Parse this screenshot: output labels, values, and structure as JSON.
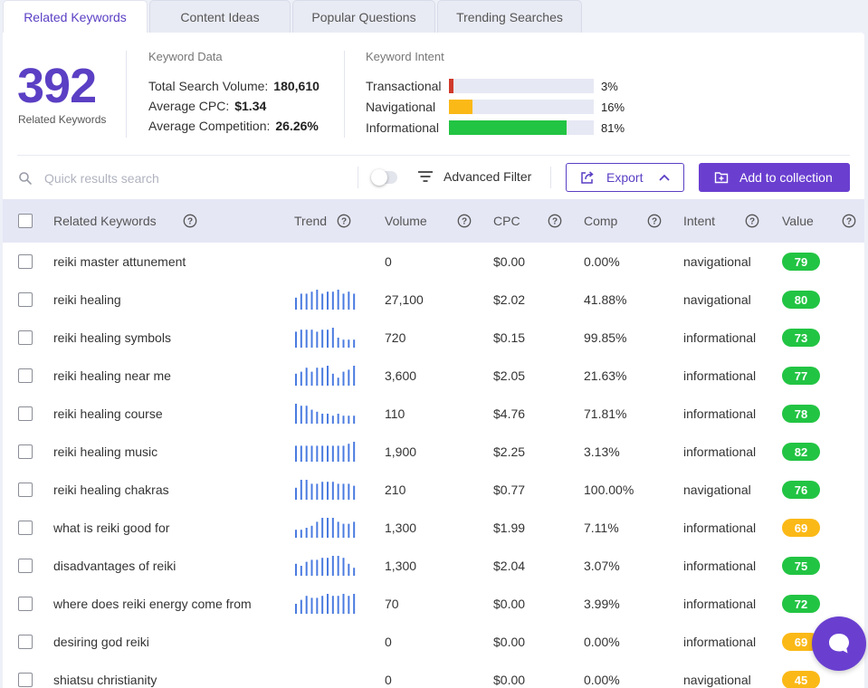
{
  "tabs": [
    {
      "label": "Related Keywords",
      "active": true
    },
    {
      "label": "Content Ideas",
      "active": false
    },
    {
      "label": "Popular Questions",
      "active": false
    },
    {
      "label": "Trending Searches",
      "active": false
    }
  ],
  "summary": {
    "count": "392",
    "count_label": "Related Keywords",
    "keyword_data_label": "Keyword Data",
    "total_volume_label": "Total Search Volume:",
    "total_volume": "180,610",
    "avg_cpc_label": "Average CPC:",
    "avg_cpc": "$1.34",
    "avg_comp_label": "Average Competition:",
    "avg_comp": "26.26%"
  },
  "intent": {
    "label": "Keyword Intent",
    "items": [
      {
        "name": "Transactional",
        "pct_label": "3%",
        "fraction": 0.03,
        "color": "#d0392b"
      },
      {
        "name": "Navigational",
        "pct_label": "16%",
        "fraction": 0.16,
        "color": "#fbb917"
      },
      {
        "name": "Informational",
        "pct_label": "81%",
        "fraction": 0.81,
        "color": "#22c443"
      }
    ]
  },
  "toolbar": {
    "search_placeholder": "Quick results search",
    "filter_label": "Advanced Filter",
    "export_label": "Export",
    "collection_label": "Add to collection"
  },
  "columns": {
    "keyword": "Related Keywords",
    "trend": "Trend",
    "volume": "Volume",
    "cpc": "CPC",
    "comp": "Comp",
    "intent": "Intent",
    "value": "Value"
  },
  "colors": {
    "accent": "#5b3fc4",
    "trend_bar": "#4a7be0",
    "value_green": "#22c443",
    "value_amber": "#fbb917"
  },
  "rows": [
    {
      "keyword": "reiki master attunement",
      "trend": [],
      "volume": "0",
      "cpc": "$0.00",
      "comp": "0.00%",
      "intent": "navigational",
      "value": "79",
      "value_color": "green"
    },
    {
      "keyword": "reiki healing",
      "trend": [
        0.6,
        0.8,
        0.8,
        0.9,
        1.0,
        0.8,
        0.9,
        0.9,
        1.0,
        0.8,
        0.9,
        0.8
      ],
      "volume": "27,100",
      "cpc": "$2.02",
      "comp": "41.88%",
      "intent": "navigational",
      "value": "80",
      "value_color": "green"
    },
    {
      "keyword": "reiki healing symbols",
      "trend": [
        0.8,
        0.9,
        0.9,
        0.9,
        0.8,
        0.9,
        0.9,
        1.0,
        0.5,
        0.4,
        0.4,
        0.4
      ],
      "volume": "720",
      "cpc": "$0.15",
      "comp": "99.85%",
      "intent": "informational",
      "value": "73",
      "value_color": "green"
    },
    {
      "keyword": "reiki healing near me",
      "trend": [
        0.6,
        0.7,
        0.9,
        0.7,
        0.9,
        0.9,
        1.0,
        0.6,
        0.4,
        0.7,
        0.8,
        1.0
      ],
      "volume": "3,600",
      "cpc": "$2.05",
      "comp": "21.63%",
      "intent": "informational",
      "value": "77",
      "value_color": "green"
    },
    {
      "keyword": "reiki healing course",
      "trend": [
        1.0,
        0.9,
        0.9,
        0.7,
        0.6,
        0.5,
        0.5,
        0.4,
        0.5,
        0.4,
        0.4,
        0.4
      ],
      "volume": "110",
      "cpc": "$4.76",
      "comp": "71.81%",
      "intent": "informational",
      "value": "78",
      "value_color": "green"
    },
    {
      "keyword": "reiki healing music",
      "trend": [
        0.8,
        0.8,
        0.8,
        0.8,
        0.8,
        0.8,
        0.8,
        0.8,
        0.8,
        0.8,
        0.9,
        1.0
      ],
      "volume": "1,900",
      "cpc": "$2.25",
      "comp": "3.13%",
      "intent": "informational",
      "value": "82",
      "value_color": "green"
    },
    {
      "keyword": "reiki healing chakras",
      "trend": [
        0.6,
        1.0,
        1.0,
        0.8,
        0.8,
        0.9,
        0.9,
        0.9,
        0.8,
        0.8,
        0.8,
        0.7
      ],
      "volume": "210",
      "cpc": "$0.77",
      "comp": "100.00%",
      "intent": "navigational",
      "value": "76",
      "value_color": "green"
    },
    {
      "keyword": "what is reiki good for",
      "trend": [
        0.4,
        0.4,
        0.5,
        0.6,
        0.8,
        1.0,
        1.0,
        1.0,
        0.8,
        0.7,
        0.7,
        0.8
      ],
      "volume": "1,300",
      "cpc": "$1.99",
      "comp": "7.11%",
      "intent": "informational",
      "value": "69",
      "value_color": "amber"
    },
    {
      "keyword": "disadvantages of reiki",
      "trend": [
        0.6,
        0.5,
        0.7,
        0.8,
        0.8,
        0.9,
        0.9,
        1.0,
        1.0,
        0.9,
        0.6,
        0.4
      ],
      "volume": "1,300",
      "cpc": "$2.04",
      "comp": "3.07%",
      "intent": "informational",
      "value": "75",
      "value_color": "green"
    },
    {
      "keyword": "where does reiki energy come from",
      "trend": [
        0.5,
        0.7,
        0.9,
        0.8,
        0.8,
        0.9,
        1.0,
        0.9,
        0.9,
        1.0,
        0.9,
        1.0
      ],
      "volume": "70",
      "cpc": "$0.00",
      "comp": "3.99%",
      "intent": "informational",
      "value": "72",
      "value_color": "green"
    },
    {
      "keyword": "desiring god reiki",
      "trend": [],
      "volume": "0",
      "cpc": "$0.00",
      "comp": "0.00%",
      "intent": "informational",
      "value": "69",
      "value_color": "amber"
    },
    {
      "keyword": "shiatsu christianity",
      "trend": [],
      "volume": "0",
      "cpc": "$0.00",
      "comp": "0.00%",
      "intent": "navigational",
      "value": "45",
      "value_color": "amber"
    }
  ]
}
